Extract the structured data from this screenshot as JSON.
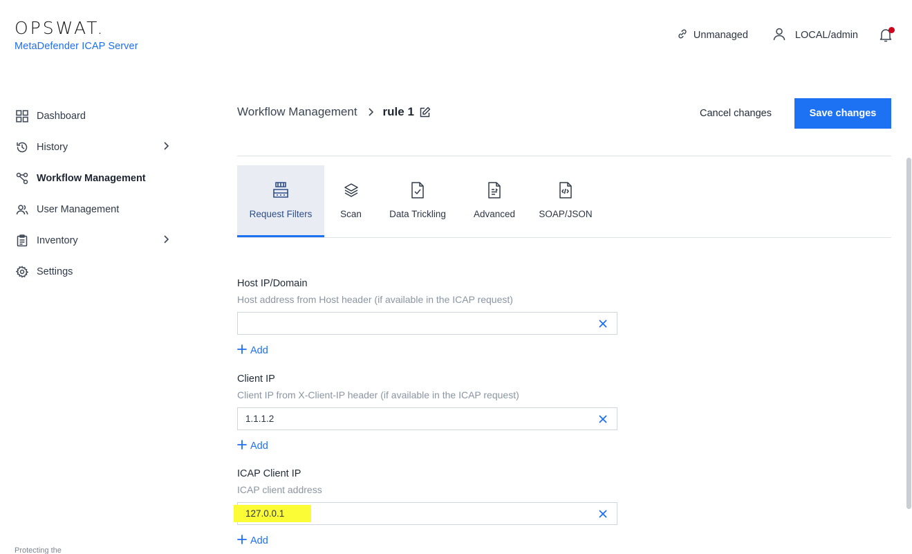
{
  "header": {
    "logo_text": "OPSWAT.",
    "product_name": "MetaDefender ICAP Server",
    "management_status": "Unmanaged",
    "user": "LOCAL/admin",
    "icons": {
      "link": "link-broken-icon",
      "user": "user-icon",
      "bell": "bell-icon"
    },
    "notification_dot_color": "#d0021b"
  },
  "sidebar": {
    "items": [
      {
        "label": "Dashboard",
        "icon": "dashboard-grid-icon",
        "has_submenu": false,
        "active": false
      },
      {
        "label": "History",
        "icon": "history-icon",
        "has_submenu": true,
        "active": false
      },
      {
        "label": "Workflow Management",
        "icon": "workflow-icon",
        "has_submenu": false,
        "active": true
      },
      {
        "label": "User Management",
        "icon": "users-icon",
        "has_submenu": false,
        "active": false
      },
      {
        "label": "Inventory",
        "icon": "clipboard-icon",
        "has_submenu": true,
        "active": false
      },
      {
        "label": "Settings",
        "icon": "gear-icon",
        "has_submenu": false,
        "active": false
      }
    ],
    "footer_text": "Protecting the"
  },
  "breadcrumb": {
    "parent": "Workflow Management",
    "current": "rule 1"
  },
  "actions": {
    "cancel_label": "Cancel changes",
    "save_label": "Save changes",
    "accent_color": "#1d72f3"
  },
  "tabs": [
    {
      "label": "Request Filters",
      "icon": "filter-server-icon",
      "active": true
    },
    {
      "label": "Scan",
      "icon": "layers-icon",
      "active": false
    },
    {
      "label": "Data Trickling",
      "icon": "file-check-icon",
      "active": false
    },
    {
      "label": "Advanced",
      "icon": "file-list-icon",
      "active": false
    },
    {
      "label": "SOAP/JSON",
      "icon": "file-code-icon",
      "active": false
    }
  ],
  "fields": [
    {
      "label": "Host IP/Domain",
      "help": "Host address from Host header (if available in the ICAP request)",
      "value": "",
      "add_label": "Add"
    },
    {
      "label": "Client IP",
      "help": "Client IP from X-Client-IP header (if available in the ICAP request)",
      "value": "1.1.1.2",
      "add_label": "Add"
    },
    {
      "label": "ICAP Client IP",
      "help": "ICAP client address",
      "value": "127.0.0.1",
      "add_label": "Add",
      "highlight_color": "#fbfb36"
    }
  ]
}
